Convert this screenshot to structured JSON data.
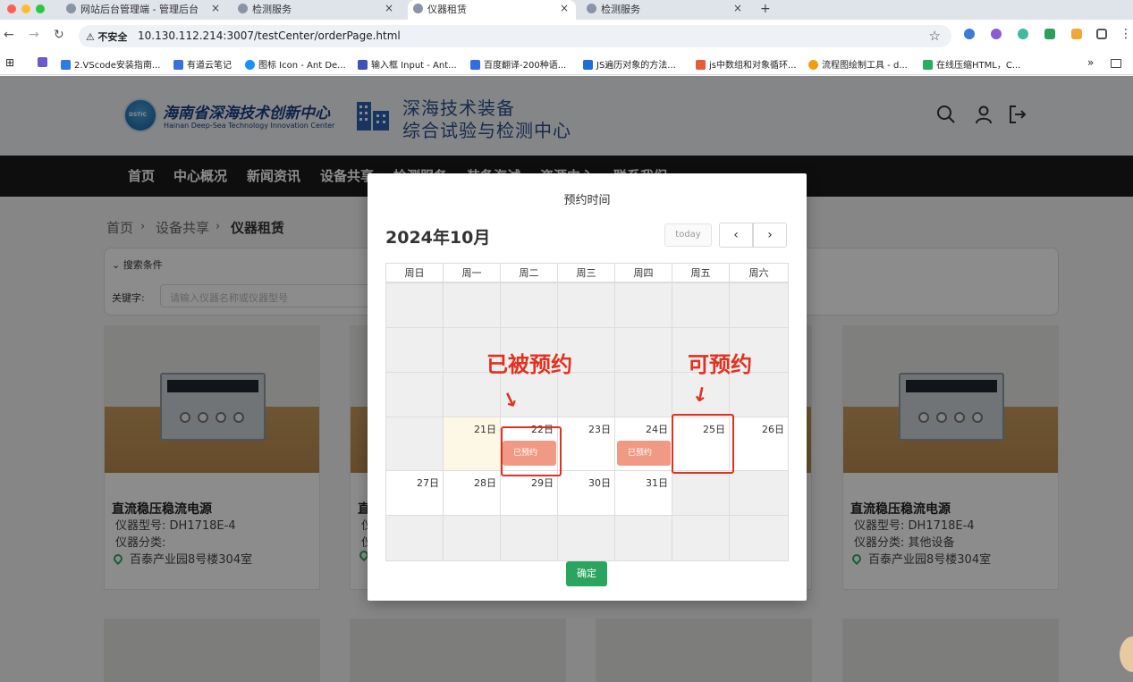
{
  "browser": {
    "tabs": [
      {
        "label": "网站后台管理端 - 管理后台",
        "active": false
      },
      {
        "label": "检测服务",
        "active": false
      },
      {
        "label": "仪器租赁",
        "active": true
      },
      {
        "label": "检测服务",
        "active": false
      }
    ],
    "new_tab": "+",
    "close": "×",
    "security_label": "不安全",
    "url": "10.130.112.214:3007/testCenter/orderPage.html",
    "bookmarks": [
      "2.VScode安装指南...",
      "有道云笔记",
      "图标 Icon - Ant De...",
      "输入框 Input - Ant...",
      "百度翻译-200种语...",
      "JS遍历对象的方法...",
      "js中数组和对象循环...",
      "流程图绘制工具 - d...",
      "在线压缩HTML，C..."
    ],
    "more": "»"
  },
  "site": {
    "logo_cn": "海南省深海技术创新中心",
    "logo_en": "Hainan Deep-Sea Technology Innovation Center",
    "logo_badge": "DSTIC",
    "center_line1": "深海技术装备",
    "center_line2": "综合试验与检测中心",
    "nav": [
      "首页",
      "中心概况",
      "新闻资讯",
      "设备共享",
      "检测服务",
      "装备海试",
      "资源中心",
      "联系我们"
    ]
  },
  "breadcrumb": [
    "首页",
    "设备共享",
    "仪器租赁"
  ],
  "breadcrumb_sep": "›",
  "search": {
    "title": "搜索条件",
    "keyword_label": "关键字:",
    "keyword_placeholder": "请输入仪器名称或仪器型号"
  },
  "cards": [
    {
      "name": "直流稳压稳流电源",
      "model_label": "仪器型号:",
      "model": "DH1718E-4",
      "category_label": "仪器分类:",
      "category": "",
      "location": "百泰产业园8号楼304室"
    },
    {
      "name": "直",
      "model_label": "仪",
      "model": "",
      "category_label": "仪",
      "category": "",
      "location": ""
    },
    {
      "name": "直流稳压稳流电源",
      "model_label": "仪器型号:",
      "model": "DH1718E-4",
      "category_label": "仪器分类:",
      "category": "其他设备",
      "location": "百泰产业园8号楼304室"
    }
  ],
  "modal": {
    "title": "预约时间",
    "calendar_title": "2024年10月",
    "today_label": "today",
    "prev": "‹",
    "next": "›",
    "weekdays": [
      "周日",
      "周一",
      "周二",
      "周三",
      "周四",
      "周五",
      "周六"
    ],
    "days": {
      "d21": "21日",
      "d22": "22日",
      "d23": "23日",
      "d24": "24日",
      "d25": "25日",
      "d26": "26日",
      "d27": "27日",
      "d28": "28日",
      "d29": "29日",
      "d30": "30日",
      "d31": "31日"
    },
    "booked_label": "已预约",
    "confirm_label": "确定"
  },
  "annotations": {
    "booked": "已被预约",
    "available": "可预约",
    "arrow": "↓",
    "color": "#e1321f"
  }
}
